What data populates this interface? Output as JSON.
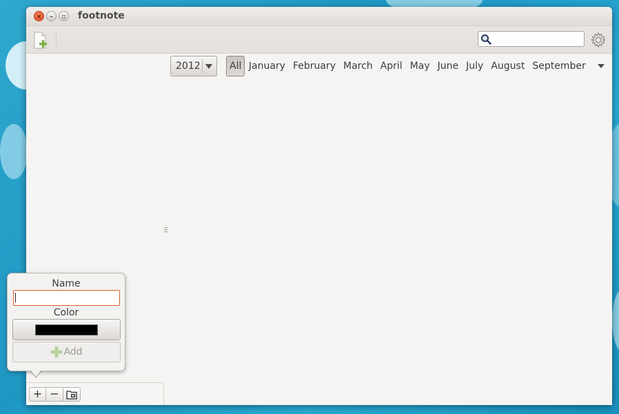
{
  "window": {
    "title": "footnote"
  },
  "colors": {
    "accent": "#e05a2a",
    "selected_color": "#000000",
    "desktop": "#2aa9d4"
  },
  "toolbar": {
    "new_note_icon": "new-note-icon",
    "search": {
      "value": "",
      "placeholder": ""
    },
    "settings_icon": "gear-icon"
  },
  "filter": {
    "year": "2012",
    "months": [
      "All",
      "January",
      "February",
      "March",
      "April",
      "May",
      "June",
      "July",
      "August",
      "September"
    ],
    "active_month": "All"
  },
  "tag_popover": {
    "name_label": "Name",
    "name_value": "",
    "color_label": "Color",
    "add_label": "Add"
  },
  "sidebar_buttons": {
    "add": "+",
    "remove": "−"
  }
}
